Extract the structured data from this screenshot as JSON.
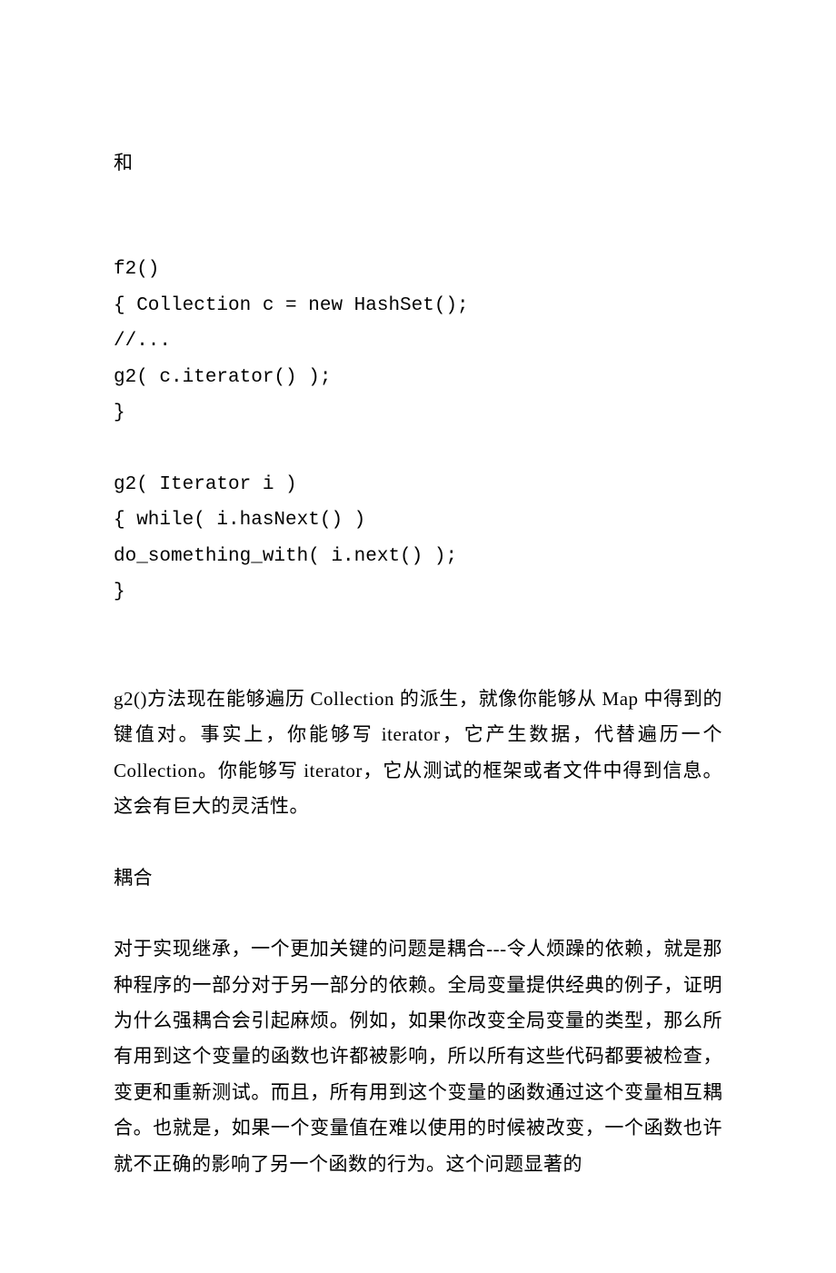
{
  "content": {
    "line1": "和",
    "code1": "f2()",
    "code2": "{ Collection c = new HashSet();",
    "code3": "//...",
    "code4": "g2( c.iterator() );",
    "code5": "}",
    "code6": "g2( Iterator i )",
    "code7": "{ while( i.hasNext() )",
    "code8": "do_something_with( i.next() );",
    "code9": "}",
    "para1": "g2()方法现在能够遍历 Collection 的派生，就像你能够从 Map 中得到的键值对。事实上，你能够写 iterator，它产生数据，代替遍历一个 Collection。你能够写 iterator，它从测试的框架或者文件中得到信息。这会有巨大的灵活性。",
    "heading1": "耦合",
    "para2": "对于实现继承，一个更加关键的问题是耦合---令人烦躁的依赖，就是那种程序的一部分对于另一部分的依赖。全局变量提供经典的例子，证明为什么强耦合会引起麻烦。例如，如果你改变全局变量的类型，那么所有用到这个变量的函数也许都被影响，所以所有这些代码都要被检查，变更和重新测试。而且，所有用到这个变量的函数通过这个变量相互耦合。也就是，如果一个变量值在难以使用的时候被改变，一个函数也许就不正确的影响了另一个函数的行为。这个问题显著的"
  }
}
